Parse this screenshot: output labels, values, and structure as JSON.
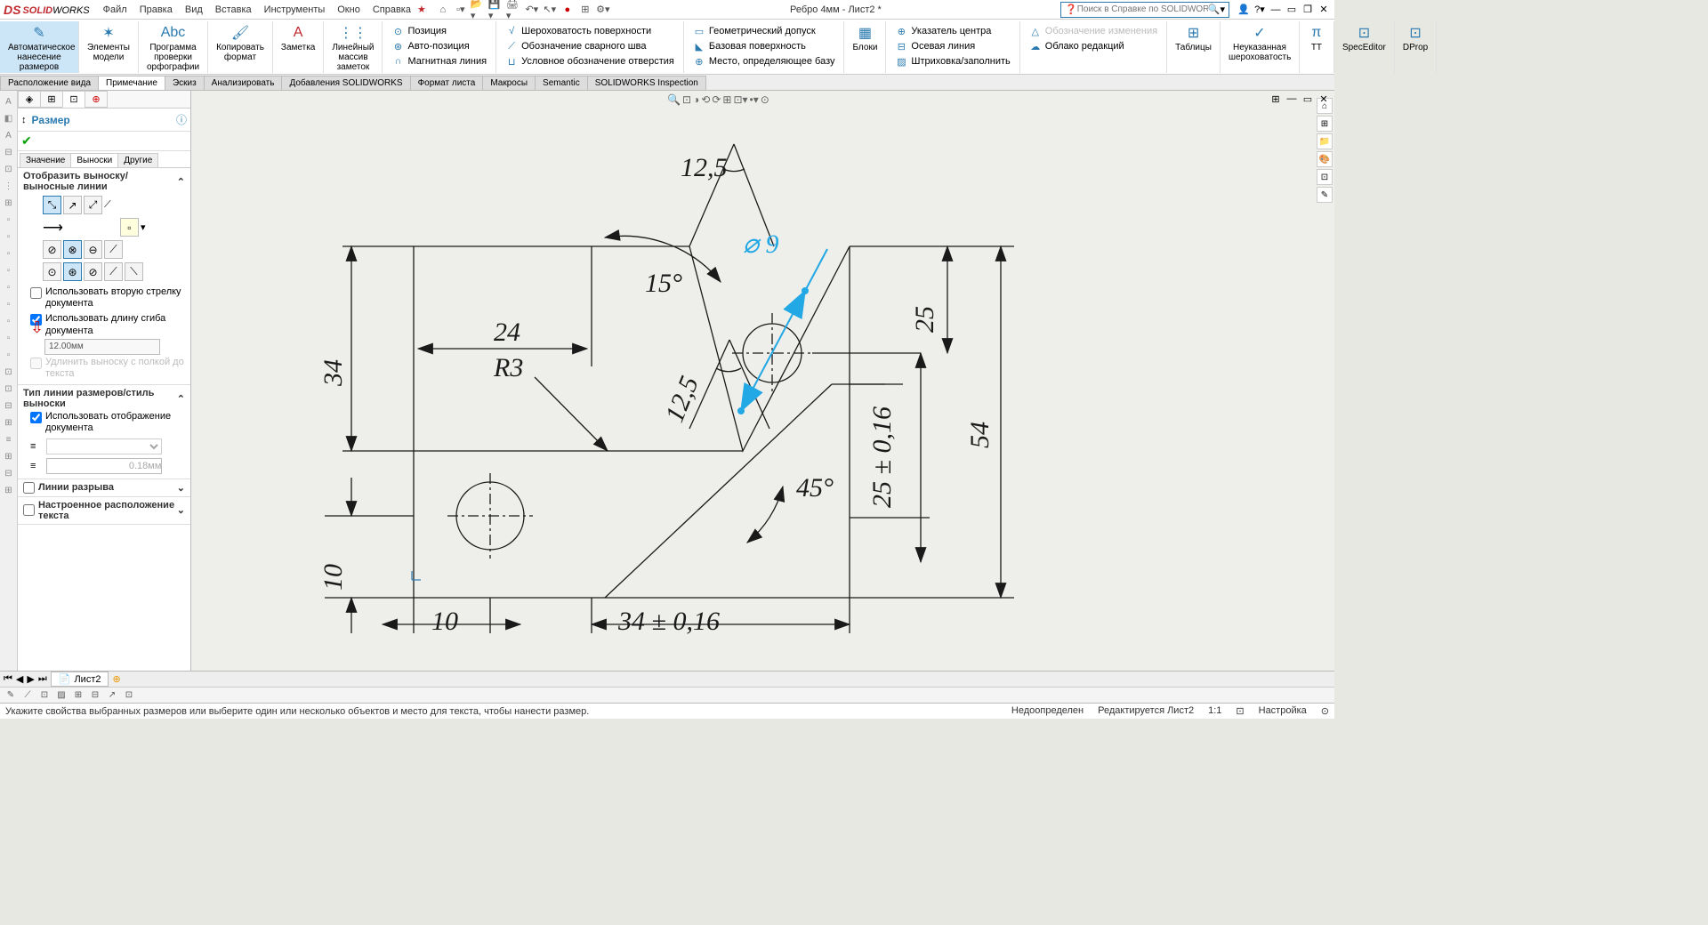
{
  "app": {
    "brand_solid": "SOLID",
    "brand_works": "WORKS",
    "title": "Ребро 4мм - Лист2 *"
  },
  "menu": [
    "Файл",
    "Правка",
    "Вид",
    "Вставка",
    "Инструменты",
    "Окно",
    "Справка"
  ],
  "search": {
    "placeholder": "Поиск в Справке по SOLIDWORKS"
  },
  "ribbon_big": [
    {
      "label": "Автоматическое\nнанесение размеров",
      "active": true
    },
    {
      "label": "Элементы\nмодели"
    },
    {
      "label": "Программа\nпроверки\nорфографии"
    },
    {
      "label": "Копировать\nформат"
    },
    {
      "label": "Заметка"
    },
    {
      "label": "Линейный\nмассив заметок"
    }
  ],
  "ribbon_small_1": [
    "Позиция",
    "Авто-позиция",
    "Магнитная линия"
  ],
  "ribbon_small_2": [
    "Шероховатость поверхности",
    "Обозначение сварного шва",
    "Условное обозначение отверстия"
  ],
  "ribbon_small_3": [
    "Геометрический допуск",
    "Базовая поверхность",
    "Место, определяющее базу"
  ],
  "ribbon_big2": {
    "label": "Блоки"
  },
  "ribbon_small_4": [
    "Указатель центра",
    "Осевая линия",
    "Штриховка/заполнить"
  ],
  "ribbon_small_5": [
    "Обозначение изменения",
    "Облако редакций"
  ],
  "ribbon_big3": [
    {
      "label": "Таблицы"
    },
    {
      "label": "Неуказанная\nшероховатость"
    },
    {
      "label": "π",
      "sub": "TT"
    },
    {
      "label": "SpecEditor"
    },
    {
      "label": "DProp"
    }
  ],
  "tabs": [
    "Расположение вида",
    "Примечание",
    "Эскиз",
    "Анализировать",
    "Добавления SOLIDWORKS",
    "Формат листа",
    "Макросы",
    "Semantic",
    "SOLIDWORKS Inspection"
  ],
  "tabs_active": 1,
  "panel": {
    "title": "Размер",
    "subtabs": [
      "Значение",
      "Выноски",
      "Другие"
    ],
    "subtab_active": 1,
    "sec1": "Отобразить выноску/выносные линии",
    "chk1": "Использовать вторую стрелку документа",
    "chk2": "Использовать длину сгиба документа",
    "val1": "12.00мм",
    "chk3": "Удлинить выноску с полкой до текста",
    "sec2": "Тип линии размеров/стиль выноски",
    "chk4": "Использовать отображение документа",
    "val2": "0.18мм",
    "sec3": "Линии разрыва",
    "sec4": "Настроенное расположение текста"
  },
  "dims": {
    "d125a": "12,5",
    "d15": "15°",
    "dia9": "⌀ 9",
    "d24": "24",
    "dR3": "R3",
    "d34a": "34",
    "d125b": "12,5",
    "d25": "25",
    "d25tol": "25 ± 0,16",
    "d54": "54",
    "d45": "45°",
    "d10": "10",
    "d10b": "10",
    "d34tol": "34 ± 0,16"
  },
  "sheet": {
    "name": "Лист2"
  },
  "status": {
    "hint": "Укажите свойства выбранных размеров или выберите один или несколько объектов и место для текста, чтобы нанести размер.",
    "s1": "Недоопределен",
    "s2": "Редактируется Лист2",
    "s3": "1:1",
    "s4": "Настройка"
  }
}
